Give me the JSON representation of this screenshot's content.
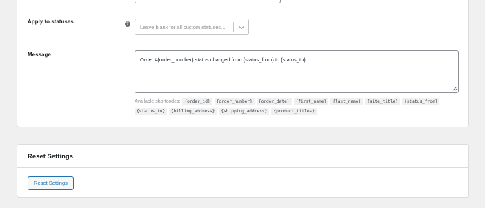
{
  "settings_form": {
    "apply_to_statuses": {
      "label": "Apply to statuses",
      "help_icon": "question-circle-icon",
      "placeholder": "Leave blank for all custom statuses...",
      "chevron_icon": "chevron-down-icon"
    },
    "message": {
      "label": "Message",
      "value": "Order #{order_number} status changed from {status_from} to {status_to}",
      "shortcodes_label": "Available shortcodes:",
      "shortcodes": [
        "{order_id}",
        "{order_number}",
        "{order_date}",
        "{first_name}",
        "{last_name}",
        "{site_title}",
        "{status_from}",
        "{status_to}",
        "{billing_address}",
        "{shipping_address}",
        "{product_titles}"
      ]
    }
  },
  "reset_section": {
    "title": "Reset Settings",
    "button_label": "Reset Settings"
  },
  "colors": {
    "page_background": "#f0f0f1",
    "card_border": "#dcdcde",
    "accent": "#2271b1",
    "muted_text": "#8c8f94"
  }
}
